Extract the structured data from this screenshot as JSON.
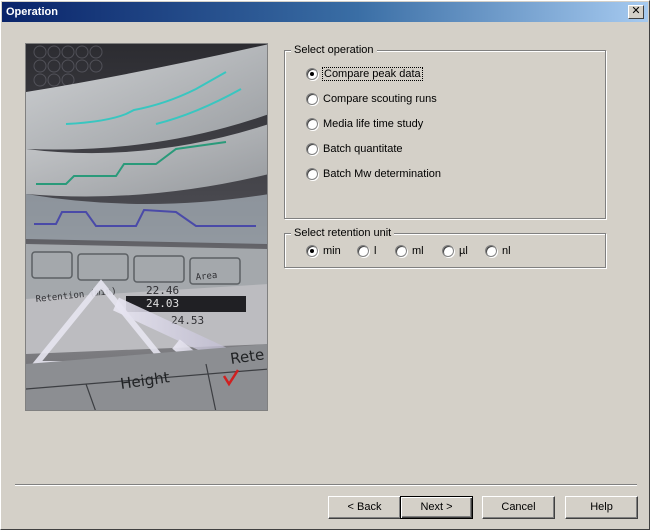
{
  "window": {
    "title": "Operation",
    "close_glyph": "✕"
  },
  "illustration": {
    "readout_rows": [
      "22.46",
      "24.03",
      "24.53"
    ],
    "header_cells": [
      "Retention (min)",
      "Area"
    ],
    "table_labels": [
      "Height",
      "Rete"
    ]
  },
  "select_operation": {
    "legend": "Select operation",
    "options": [
      {
        "label": "Compare peak data",
        "checked": true
      },
      {
        "label": "Compare scouting runs",
        "checked": false
      },
      {
        "label": "Media life time study",
        "checked": false
      },
      {
        "label": "Batch quantitate",
        "checked": false
      },
      {
        "label": "Batch Mw determination",
        "checked": false
      }
    ]
  },
  "retention_unit": {
    "legend": "Select retention unit",
    "options": [
      {
        "label": "min",
        "checked": true
      },
      {
        "label": "l",
        "checked": false
      },
      {
        "label": "ml",
        "checked": false
      },
      {
        "label": "µl",
        "checked": false
      },
      {
        "label": "nl",
        "checked": false
      }
    ]
  },
  "buttons": {
    "back": "< Back",
    "next": "Next >",
    "cancel": "Cancel",
    "help": "Help"
  }
}
